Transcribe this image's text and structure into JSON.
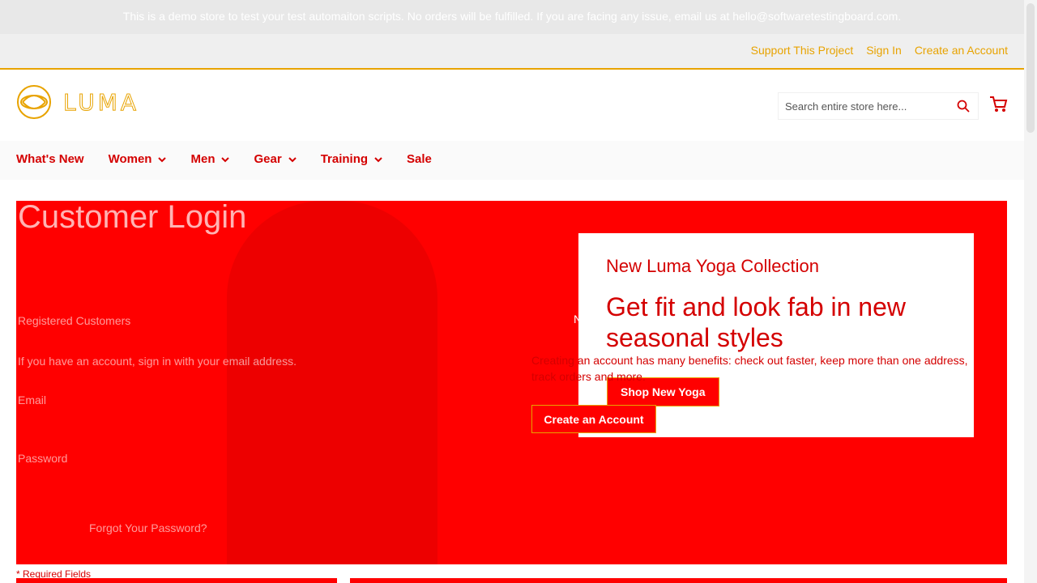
{
  "notice": "This is a demo store to test your test automaiton scripts. No orders will be fulfilled. If you are facing any issue, email us at hello@softwaretestingboard.com.",
  "panel": {
    "support_link": "Support This Project",
    "welcome_text": "Sign In",
    "create_account_link": "Create an Account"
  },
  "logo_text": "LUMA",
  "search": {
    "placeholder": "Search entire store here..."
  },
  "nav": {
    "whats_new": "What's New",
    "women": "Women",
    "men": "Men",
    "gear": "Gear",
    "training": "Training",
    "sale": "Sale"
  },
  "page": {
    "bg_title": "Customer Login",
    "registered": "Registered Customers",
    "hint": "If you have an account, sign in with your email address.",
    "email_label": "Email",
    "password_label": "Password",
    "forgot": "Forgot Your Password?",
    "new_customers": "New Customers",
    "new_info_1": "Creating an account has many benefits: check out faster, keep more than one address,",
    "new_info_2": "track orders and more.",
    "create_button": "Create an Account",
    "required": "* Required Fields"
  },
  "promo": {
    "kicker": "New Luma Yoga Collection",
    "headline": "Get fit and look fab in new seasonal styles",
    "cta": "Shop New Yoga"
  },
  "colors": {
    "accent": "#e8a300",
    "brand_red": "#ff0000",
    "nav_red": "#d40000"
  }
}
